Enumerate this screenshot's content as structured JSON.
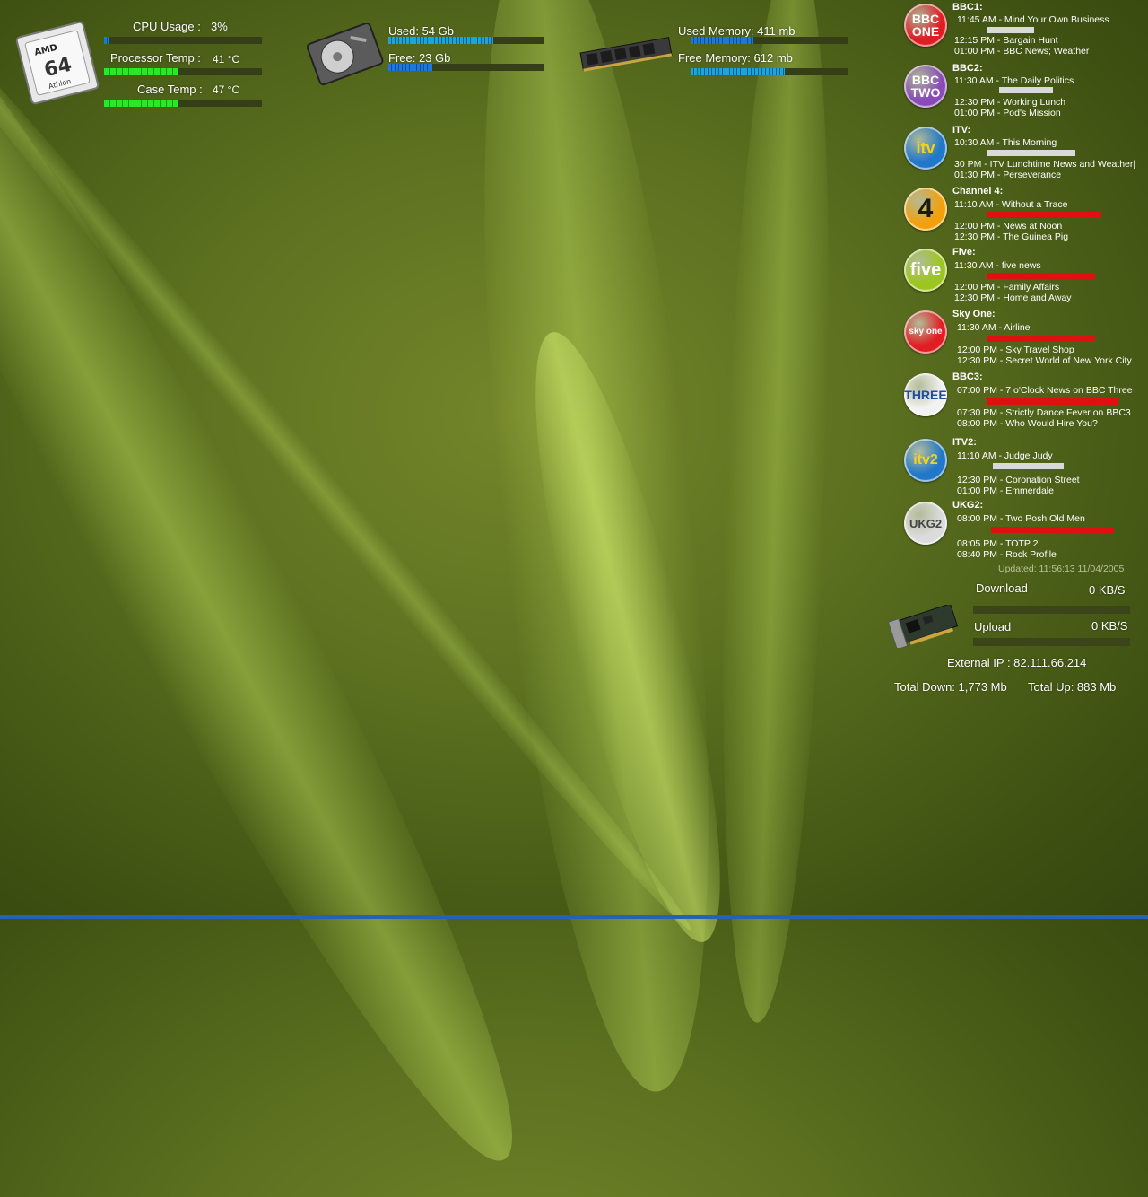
{
  "cpu": {
    "usage_label": "CPU Usage :",
    "usage_value": "3%",
    "usage_fraction": 0.03,
    "proc_temp_label": "Processor Temp :",
    "proc_temp_value": "41 °C",
    "proc_temp_fraction": 0.47,
    "case_temp_label": "Case Temp :",
    "case_temp_value": "47 °C",
    "case_temp_fraction": 0.47
  },
  "disk": {
    "used_label": "Used: 54 Gb",
    "used_fraction": 0.67,
    "free_label": "Free: 23 Gb",
    "free_fraction": 0.28
  },
  "memory": {
    "used_label": "Used Memory: 411 mb",
    "used_fraction": 0.4,
    "free_label": "Free Memory: 612 mb",
    "free_fraction": 0.6
  },
  "tv_guide": {
    "channels": [
      {
        "name": "BBC1:",
        "logo_text": "BBC\nONE",
        "logo_bg": "#e01d22",
        "now": "11:45 AM - Mind Your Own Business",
        "next1": "12:15 PM - Bargain Hunt",
        "next2": "01:00 PM - BBC News; Weather",
        "progress_color": "#d9d9d9"
      },
      {
        "name": "BBC2:",
        "logo_text": "BBC\nTWO",
        "logo_bg": "#8a4bb8",
        "now": "11:30 AM - The Daily Politics",
        "next1": "12:30 PM - Working Lunch",
        "next2": "01:00 PM - Pod's Mission",
        "progress_color": "#d9d9d9"
      },
      {
        "name": "ITV:",
        "logo_text": "itv",
        "logo_bg": "#2178c8",
        "now": "10:30 AM - This Morning",
        "next1": "30 PM - ITV Lunchtime News and Weather|",
        "next2": "01:30 PM - Perseverance",
        "progress_color": "#d9d9d9"
      },
      {
        "name": "Channel 4:",
        "logo_text": "4",
        "logo_bg": "#f2a10c",
        "now": "11:10 AM - Without a Trace",
        "next1": "12:00 PM - News at Noon",
        "next2": "12:30 PM - The Guinea Pig",
        "progress_color": "#e01010"
      },
      {
        "name": "Five:",
        "logo_text": "five",
        "logo_bg": "#9cc61e",
        "now": "11:30 AM - five news",
        "next1": "12:00 PM - Family Affairs",
        "next2": "12:30 PM - Home and Away",
        "progress_color": "#e01010"
      },
      {
        "name": "Sky One:",
        "logo_text": "sky one",
        "logo_bg": "#e01d22",
        "now": "11:30 AM - Airline",
        "next1": "12:00 PM - Sky Travel Shop",
        "next2": "12:30 PM - Secret World of New York City",
        "progress_color": "#e01010"
      },
      {
        "name": "BBC3:",
        "logo_text": "THREE",
        "logo_bg": "#f2f2f2",
        "now": "07:00 PM - 7 o'Clock News on BBC Three",
        "next1": "07:30 PM - Strictly Dance Fever on BBC3",
        "next2": "08:00 PM - Who Would Hire You?",
        "progress_color": "#e01010"
      },
      {
        "name": "ITV2:",
        "logo_text": "itv2",
        "logo_bg": "#2178c8",
        "now": "11:10 AM - Judge Judy",
        "next1": "12:30 PM - Coronation Street",
        "next2": "01:00 PM - Emmerdale",
        "progress_color": "#d9d9d9"
      },
      {
        "name": "UKG2:",
        "logo_text": "UKG2",
        "logo_bg": "#dcdcdc",
        "now": "08:00 PM - Two Posh Old Men",
        "next1": "08:05 PM - TOTP 2",
        "next2": "08:40 PM - Rock Profile",
        "progress_color": "#e01010"
      }
    ],
    "updated": "Updated: 11:56:13 11/04/2005"
  },
  "network": {
    "download_label": "Download",
    "download_value": "0 KB/S",
    "upload_label": "Upload",
    "upload_value": "0 KB/S",
    "external_ip": "External IP : 82.111.66.214",
    "total_down": "Total Down: 1,773 Mb",
    "total_up": "Total Up: 883 Mb"
  },
  "icons": [
    "amd-athlon-chip-icon",
    "hard-drive-icon",
    "memory-module-icon",
    "network-card-icon"
  ]
}
